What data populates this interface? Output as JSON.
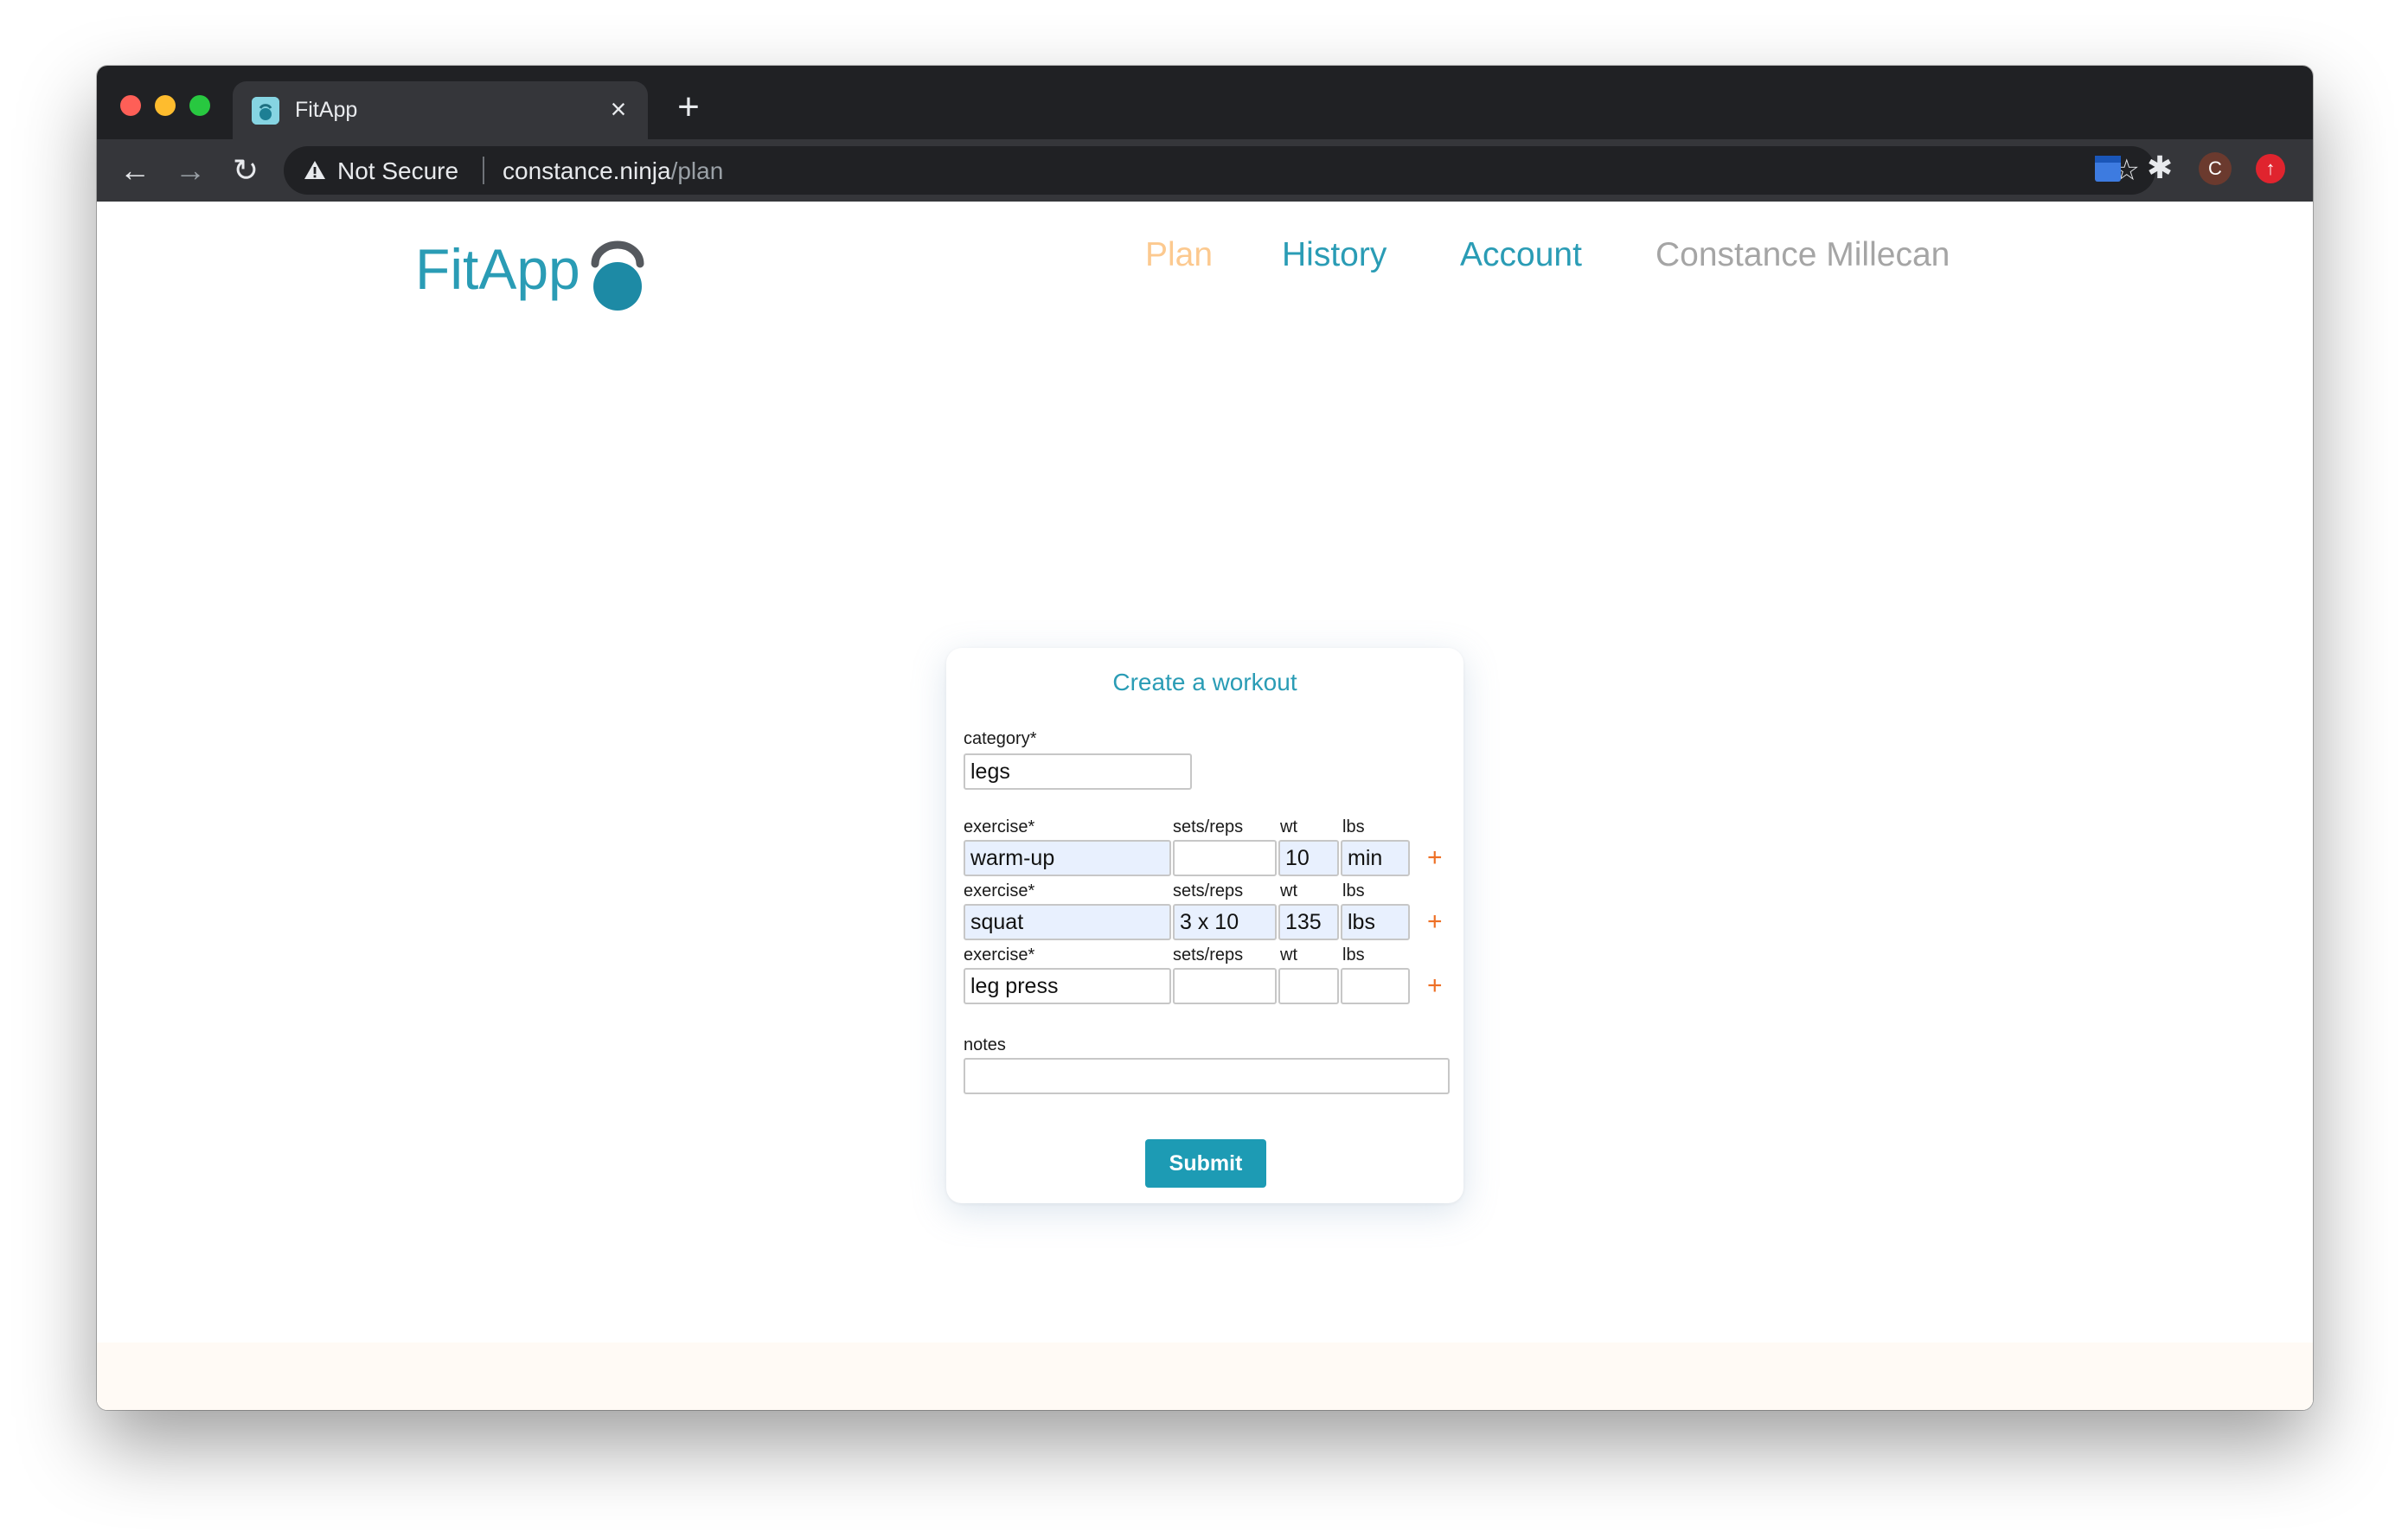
{
  "browser": {
    "tab_title": "FitApp",
    "tab_close": "×",
    "new_tab": "+",
    "back": "←",
    "forward": "→",
    "reload": "↻",
    "security_label": "Not Secure",
    "url_host": "constance.ninja",
    "url_path": "/plan",
    "bookmark": "☆",
    "extensions": "✱",
    "profile_initial": "C",
    "update": "↑"
  },
  "app": {
    "logo": "FitApp",
    "nav": {
      "plan": "Plan",
      "history": "History",
      "account": "Account",
      "user": "Constance Millecan"
    },
    "colors": {
      "brand": "#2a9cb5",
      "nav_active": "#fcc98f",
      "add_icon": "#ee6f25"
    }
  },
  "form": {
    "title": "Create a workout",
    "category_label": "category*",
    "category_value": "legs",
    "exercise_label": "exercise*",
    "setsreps_label": "sets/reps",
    "wt_label": "wt",
    "unit_label": "lbs",
    "add": "+",
    "rows": [
      {
        "exercise": "warm-up",
        "setsreps": "",
        "wt": "10",
        "unit": "min"
      },
      {
        "exercise": "squat",
        "setsreps": "3 x 10",
        "wt": "135",
        "unit": "lbs"
      },
      {
        "exercise": "leg press",
        "setsreps": "",
        "wt": "",
        "unit": ""
      }
    ],
    "notes_label": "notes",
    "notes_value": "",
    "submit": "Submit"
  }
}
